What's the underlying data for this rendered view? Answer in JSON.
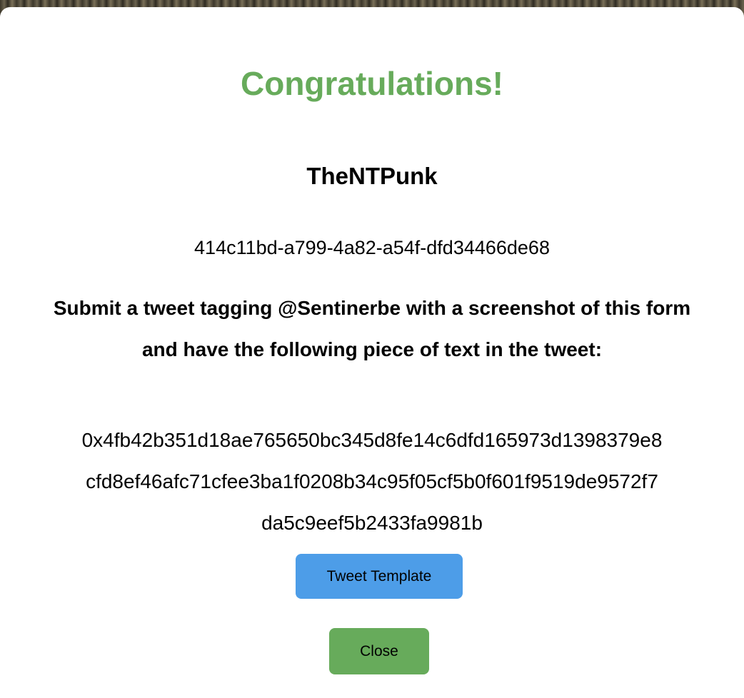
{
  "modal": {
    "title": "Congratulations!",
    "username": "TheNTPunk",
    "uuid": "414c11bd-a799-4a82-a54f-dfd34466de68",
    "instructions": "Submit a tweet tagging @Sentinerbe with a screenshot of this form and have the following piece of text in the tweet:",
    "hash_lines": [
      "0x4fb42b351d18ae765650bc345d8fe14c6dfd165973d1398379e8",
      "cfd8ef46afc71cfee3ba1f0208b34c95f05cf5b0f601f9519de9572f7",
      "da5c9eef5b2433fa9981b"
    ],
    "tweet_button_label": "Tweet Template",
    "close_button_label": "Close"
  },
  "colors": {
    "title_green": "#67ab5b",
    "tweet_button_blue": "#4d9de8",
    "close_button_green": "#67ab5b"
  }
}
